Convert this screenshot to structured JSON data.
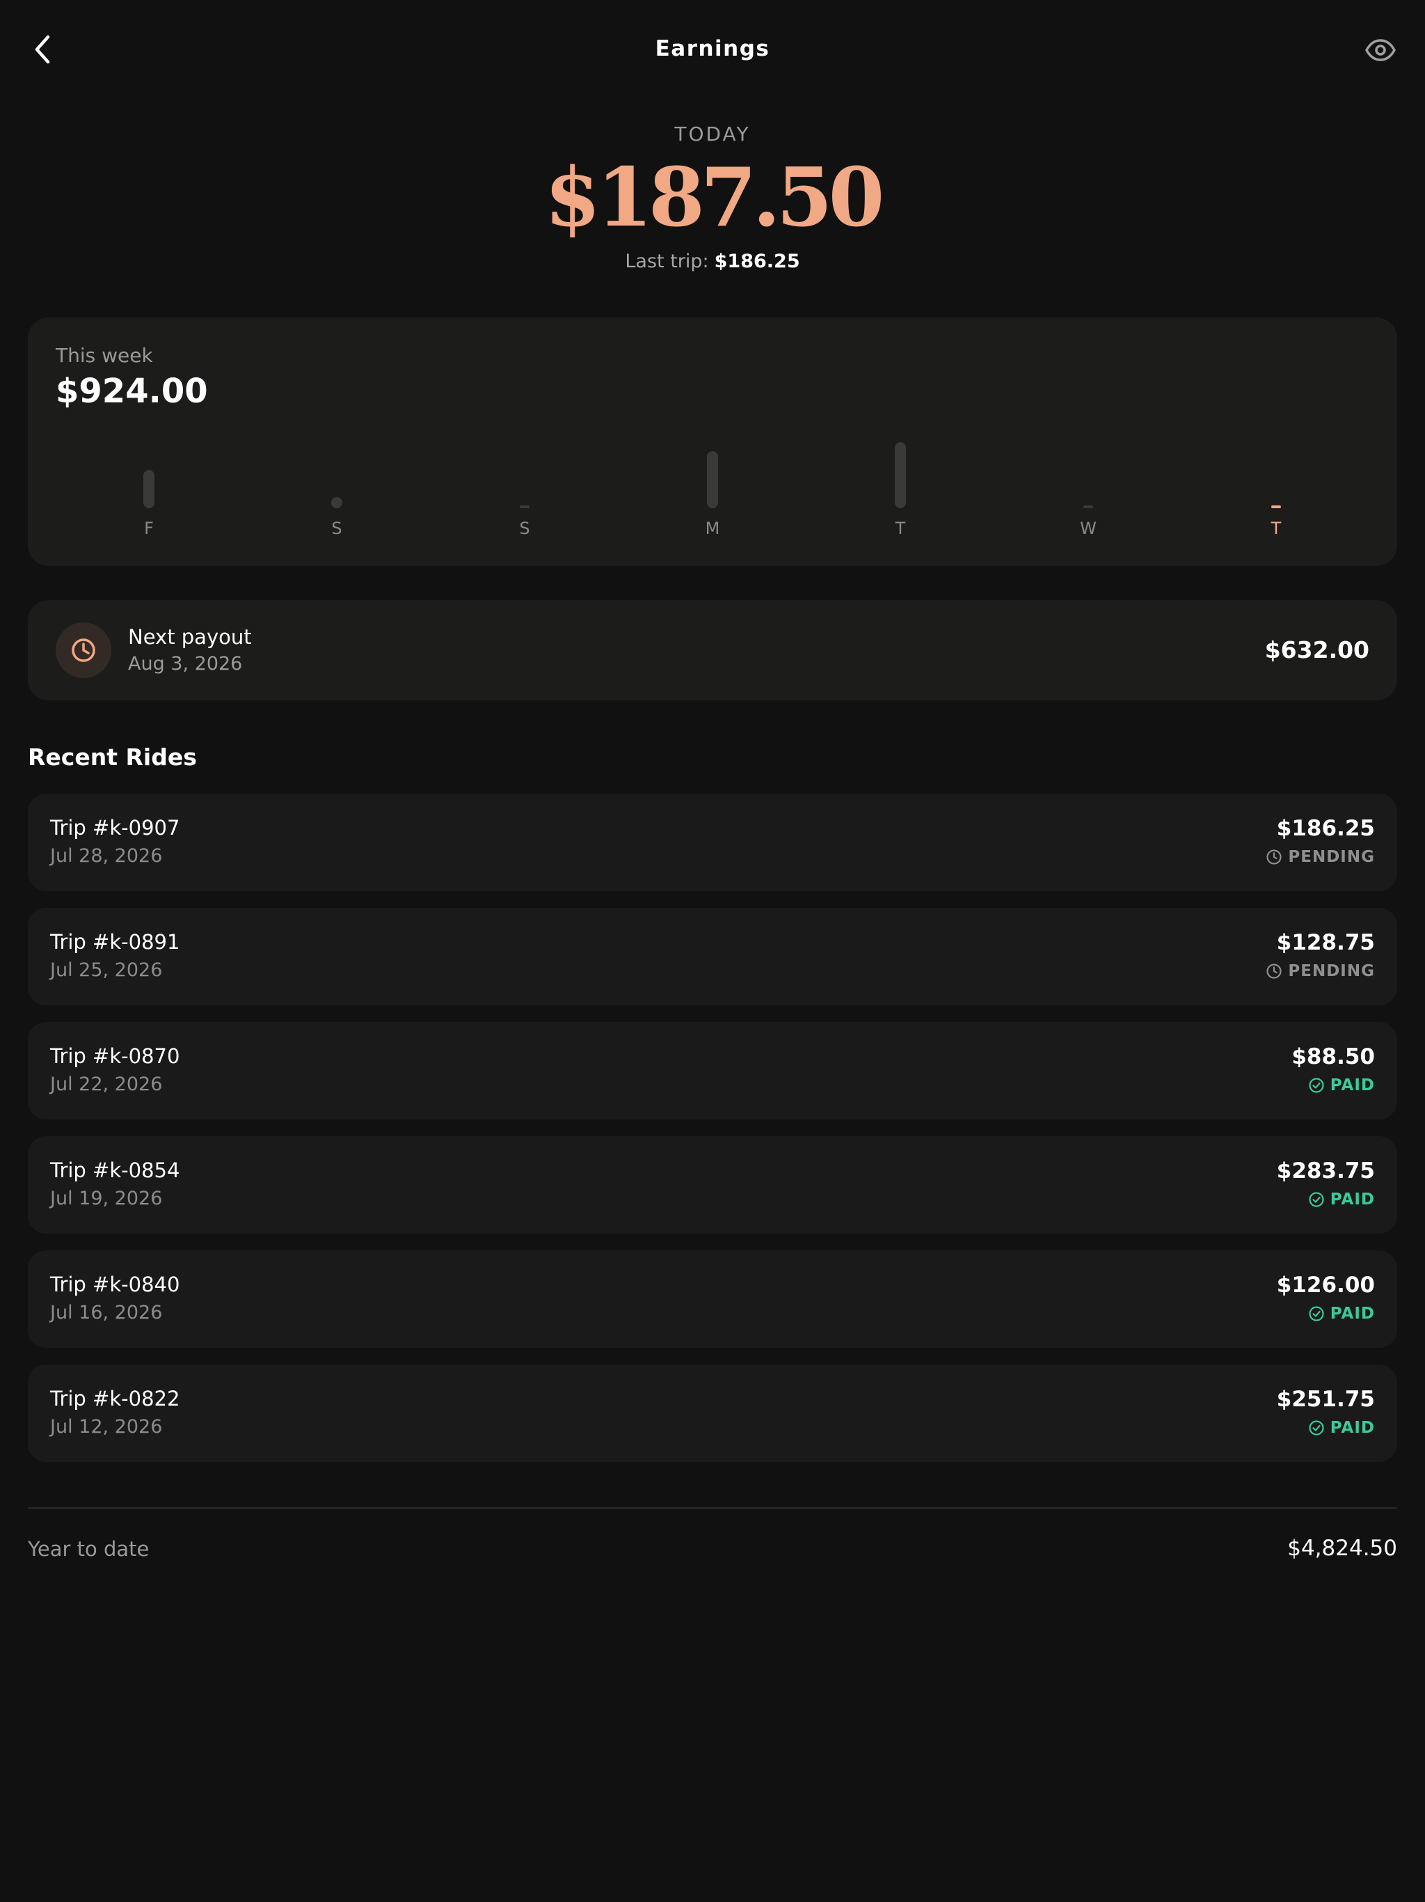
{
  "header": {
    "title": "Earnings",
    "back_icon": "chevron-left-icon",
    "visibility_icon": "eye-icon"
  },
  "hero": {
    "label": "TODAY",
    "amount": "$187.50",
    "last_trip_label": "Last trip:",
    "last_trip_value": "$186.25"
  },
  "week": {
    "label": "This week",
    "total": "$924.00",
    "days": [
      {
        "label": "F",
        "level": 0.55,
        "active": false
      },
      {
        "label": "S",
        "level": 0.12,
        "active": false
      },
      {
        "label": "S",
        "level": 0.0,
        "active": false
      },
      {
        "label": "M",
        "level": 0.82,
        "active": false
      },
      {
        "label": "T",
        "level": 0.95,
        "active": false
      },
      {
        "label": "W",
        "level": 0.0,
        "active": false
      },
      {
        "label": "T",
        "level": 0.0,
        "active": true
      }
    ]
  },
  "payout": {
    "icon": "clock-icon",
    "title": "Next payout",
    "date": "Aug 3, 2026",
    "amount": "$632.00"
  },
  "recent": {
    "title": "Recent Rides",
    "rides": [
      {
        "title": "Trip #k-0907",
        "date": "Jul 28, 2026",
        "amount": "$186.25",
        "status": "PENDING"
      },
      {
        "title": "Trip #k-0891",
        "date": "Jul 25, 2026",
        "amount": "$128.75",
        "status": "PENDING"
      },
      {
        "title": "Trip #k-0870",
        "date": "Jul 22, 2026",
        "amount": "$88.50",
        "status": "PAID"
      },
      {
        "title": "Trip #k-0854",
        "date": "Jul 19, 2026",
        "amount": "$283.75",
        "status": "PAID"
      },
      {
        "title": "Trip #k-0840",
        "date": "Jul 16, 2026",
        "amount": "$126.00",
        "status": "PAID"
      },
      {
        "title": "Trip #k-0822",
        "date": "Jul 12, 2026",
        "amount": "$251.75",
        "status": "PAID"
      }
    ]
  },
  "ytd": {
    "label": "Year to date",
    "value": "$4,824.50"
  },
  "colors": {
    "accent": "#f1a884",
    "paid": "#3cc99b",
    "pending": "#8f8f8f",
    "background": "#111111",
    "card": "#1c1c1b"
  }
}
